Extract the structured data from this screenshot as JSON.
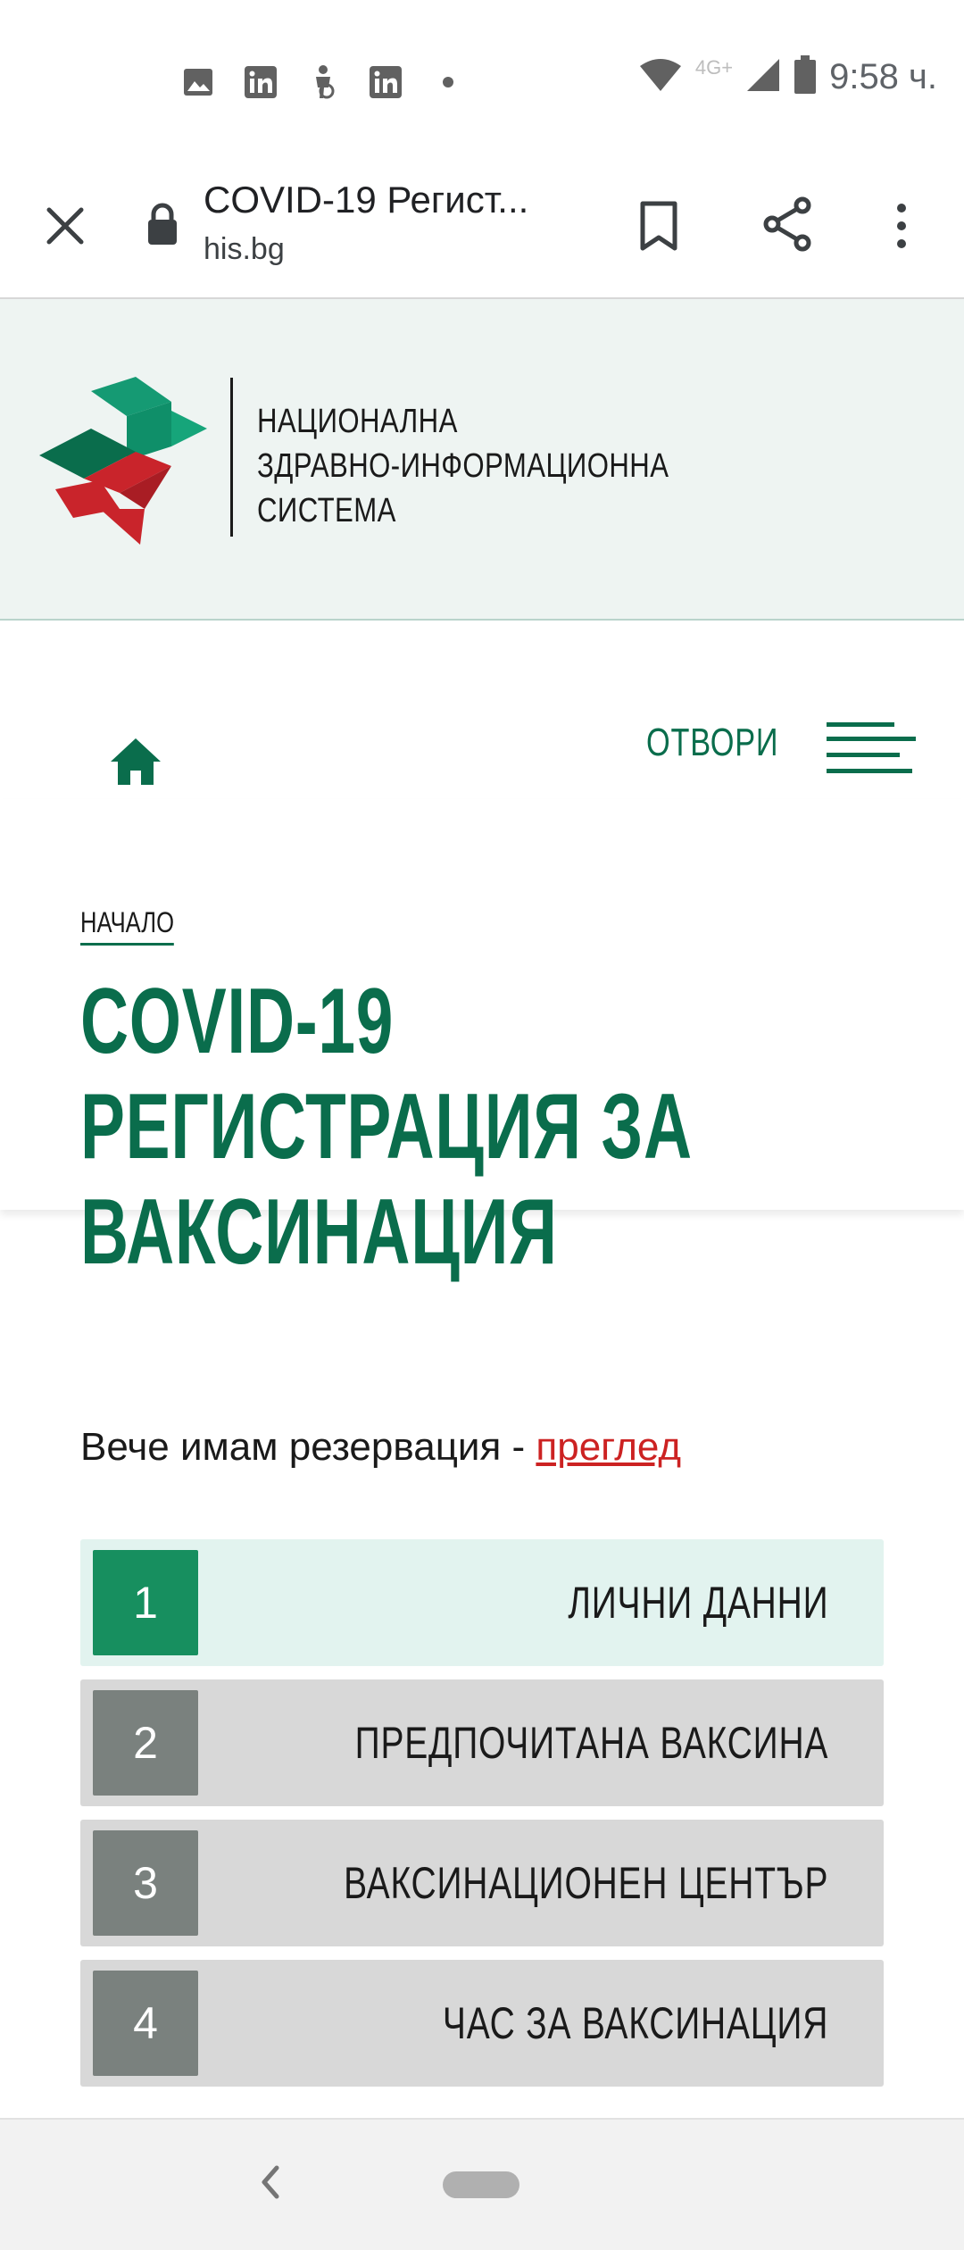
{
  "status_bar": {
    "time": "9:58 ч.",
    "network": "4G+",
    "left_icons": [
      "image-icon",
      "linkedin-icon",
      "accessibility-icon",
      "linkedin-icon",
      "dot-icon"
    ],
    "right_icons": [
      "wifi-icon",
      "signal-icon",
      "battery-icon"
    ]
  },
  "toolbar": {
    "title": "COVID-19 Регист...",
    "url": "his.bg"
  },
  "site": {
    "logo_line1": "НАЦИОНАЛНА",
    "logo_line2": "ЗДРАВНО-ИНФОРМАЦИОННА",
    "logo_line3": "СИСТЕМА"
  },
  "nav": {
    "open_label": "ОТВОРИ"
  },
  "page": {
    "breadcrumb": "НАЧАЛО",
    "title": "COVID-19 РЕГИСТРАЦИЯ ЗА ВАКСИНАЦИЯ"
  },
  "reservation": {
    "text": "Вече имам резервация - ",
    "link": "преглед"
  },
  "steps": [
    {
      "number": "1",
      "label": "ЛИЧНИ ДАННИ",
      "active": true
    },
    {
      "number": "2",
      "label": "ПРЕДПОЧИТАНА ВАКСИНА",
      "active": false
    },
    {
      "number": "3",
      "label": "ВАКСИНАЦИОНЕН ЦЕНТЪР",
      "active": false
    },
    {
      "number": "4",
      "label": "ЧАС ЗА ВАКСИНАЦИЯ",
      "active": false
    }
  ],
  "colors": {
    "brand_green": "#0a6d4c",
    "active_step": "#178f5f",
    "link_red": "#cc2222"
  }
}
